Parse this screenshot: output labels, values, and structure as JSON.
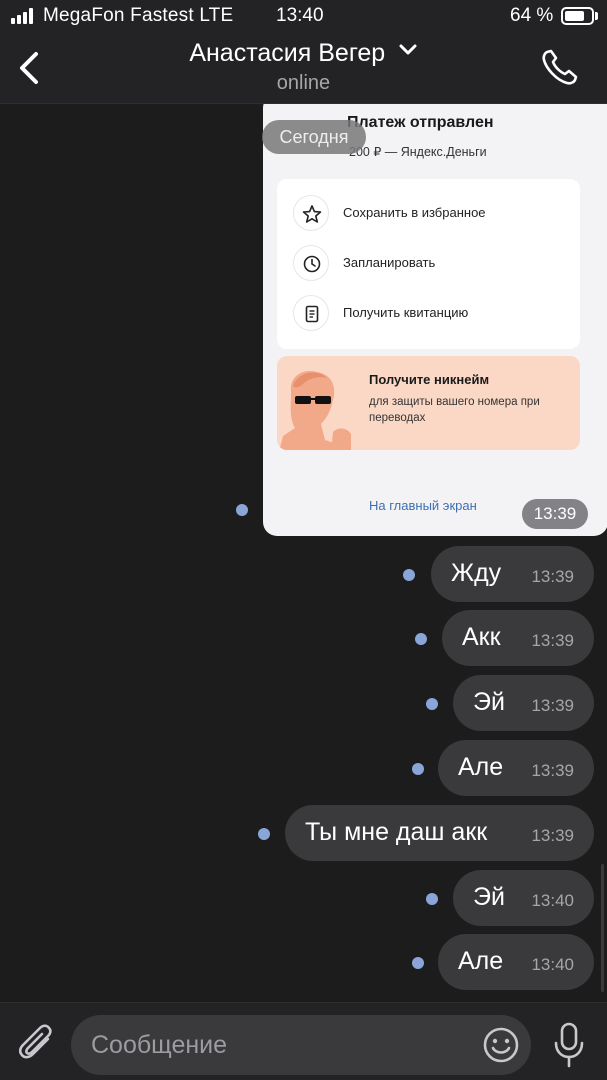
{
  "status_bar": {
    "carrier": "MegaFon Fastest LTE",
    "time": "13:40",
    "battery": "64 %",
    "battery_level": 0.64
  },
  "header": {
    "contact_name": "Анастасия Вегер",
    "status": "online",
    "icons": [
      "chevron-left-icon",
      "chevron-down-icon",
      "phone-icon"
    ]
  },
  "chat": {
    "date_separator": "Сегодня",
    "image_message": {
      "time": "13:39",
      "screenshot": {
        "title": "Платеж отправлен",
        "subtitle": "200 ₽ — Яндекс.Деньги",
        "actions": [
          {
            "label": "Сохранить в избранное",
            "icon": "star-icon"
          },
          {
            "label": "Запланировать",
            "icon": "clock-icon"
          },
          {
            "label": "Получить квитанцию",
            "icon": "receipt-icon"
          }
        ],
        "promo_title": "Получите никнейм",
        "promo_subtitle": "для защиты вашего номера при переводах",
        "home_link": "На главный экран"
      }
    },
    "messages": [
      {
        "text": "Жду",
        "time": "13:39"
      },
      {
        "text": "Акк",
        "time": "13:39"
      },
      {
        "text": "Эй",
        "time": "13:39"
      },
      {
        "text": "Але",
        "time": "13:39"
      },
      {
        "text": "Ты мне даш акк",
        "time": "13:39"
      },
      {
        "text": "Эй",
        "time": "13:40"
      },
      {
        "text": "Але",
        "time": "13:40"
      }
    ]
  },
  "composer": {
    "placeholder": "Сообщение",
    "icons": [
      "paperclip-icon",
      "emoji-icon",
      "microphone-icon"
    ]
  },
  "colors": {
    "background": "#1c1c1d",
    "bar": "#232325",
    "bubble": "#3a3a3c",
    "unread_dot": "#8aa5d8",
    "link": "#3d6fb3"
  }
}
